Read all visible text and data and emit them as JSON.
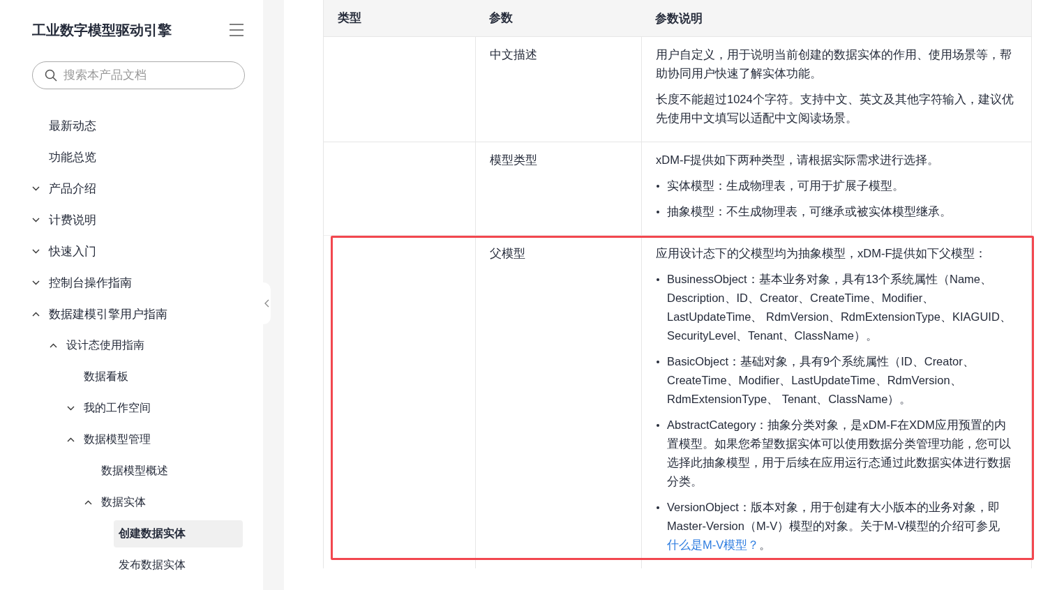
{
  "sidebar": {
    "title": "工业数字模型驱动引擎",
    "search": {
      "placeholder": "搜索本产品文档"
    },
    "items": [
      {
        "label": "最新动态",
        "kind": "leaf",
        "selected": false
      },
      {
        "label": "功能总览",
        "kind": "leaf",
        "selected": false
      },
      {
        "label": "产品介绍",
        "kind": "group",
        "expanded": false,
        "selected": false
      },
      {
        "label": "计费说明",
        "kind": "group",
        "expanded": false,
        "selected": false
      },
      {
        "label": "快速入门",
        "kind": "group",
        "expanded": false,
        "selected": false
      },
      {
        "label": "控制台操作指南",
        "kind": "group",
        "expanded": false,
        "selected": false
      },
      {
        "label": "数据建模引擎用户指南",
        "kind": "group",
        "expanded": true,
        "selected": false,
        "children": [
          {
            "label": "设计态使用指南",
            "kind": "group",
            "expanded": true,
            "selected": false,
            "children": [
              {
                "label": "数据看板",
                "kind": "leaf",
                "selected": false
              },
              {
                "label": "我的工作空间",
                "kind": "group",
                "expanded": false,
                "selected": false
              },
              {
                "label": "数据模型管理",
                "kind": "group",
                "expanded": true,
                "selected": false,
                "children": [
                  {
                    "label": "数据模型概述",
                    "kind": "leaf",
                    "selected": false
                  },
                  {
                    "label": "数据实体",
                    "kind": "group",
                    "expanded": true,
                    "selected": false,
                    "children": [
                      {
                        "label": "创建数据实体",
                        "kind": "leaf",
                        "selected": true
                      },
                      {
                        "label": "发布数据实体",
                        "kind": "leaf",
                        "selected": false
                      }
                    ]
                  }
                ]
              }
            ]
          }
        ]
      }
    ]
  },
  "table": {
    "columns": [
      "类型",
      "参数",
      "参数说明"
    ],
    "rows": [
      {
        "parameter": "中文描述",
        "highlighted": false,
        "description": [
          {
            "kind": "paragraph",
            "text": "用户自定义，用于说明当前创建的数据实体的作用、使用场景等，帮助协同用户快速了解实体功能。"
          },
          {
            "kind": "paragraph",
            "text": "长度不能超过1024个字符。支持中文、英文及其他字符输入，建议优先使用中文填写以适配中文阅读场景。"
          }
        ]
      },
      {
        "parameter": "模型类型",
        "highlighted": false,
        "description": [
          {
            "kind": "paragraph",
            "text": "xDM-F提供如下两种类型，请根据实际需求进行选择。"
          },
          {
            "kind": "bullet",
            "text": "实体模型：生成物理表，可用于扩展子模型。"
          },
          {
            "kind": "bullet",
            "text": "抽象模型：不生成物理表，可继承或被实体模型继承。"
          }
        ]
      },
      {
        "parameter": "父模型",
        "highlighted": true,
        "description": [
          {
            "kind": "paragraph",
            "text": "应用设计态下的父模型均为抽象模型，xDM-F提供如下父模型："
          },
          {
            "kind": "bullet",
            "text": "BusinessObject：基本业务对象，具有13个系统属性（Name、Description、ID、Creator、CreateTime、Modifier、LastUpdateTime、 RdmVersion、RdmExtensionType、KIAGUID、SecurityLevel、Tenant、ClassName）。"
          },
          {
            "kind": "bullet",
            "text": "BasicObject：基础对象，具有9个系统属性（ID、Creator、CreateTime、Modifier、LastUpdateTime、RdmVersion、RdmExtensionType、 Tenant、ClassName）。"
          },
          {
            "kind": "bullet",
            "text": "AbstractCategory：抽象分类对象，是xDM-F在XDM应用预置的内置模型。如果您希望数据实体可以使用数据分类管理功能，您可以选择此抽象模型，用于后续在应用运行态通过此数据实体进行数据分类。"
          },
          {
            "kind": "bullet",
            "text": "VersionObject：版本对象，用于创建有大小版本的业务对象，即Master-Version（M-V）模型的对象。关于M-V模型的介绍可参见",
            "link": "什么是M-V模型？",
            "tail": "。"
          }
        ]
      }
    ]
  }
}
